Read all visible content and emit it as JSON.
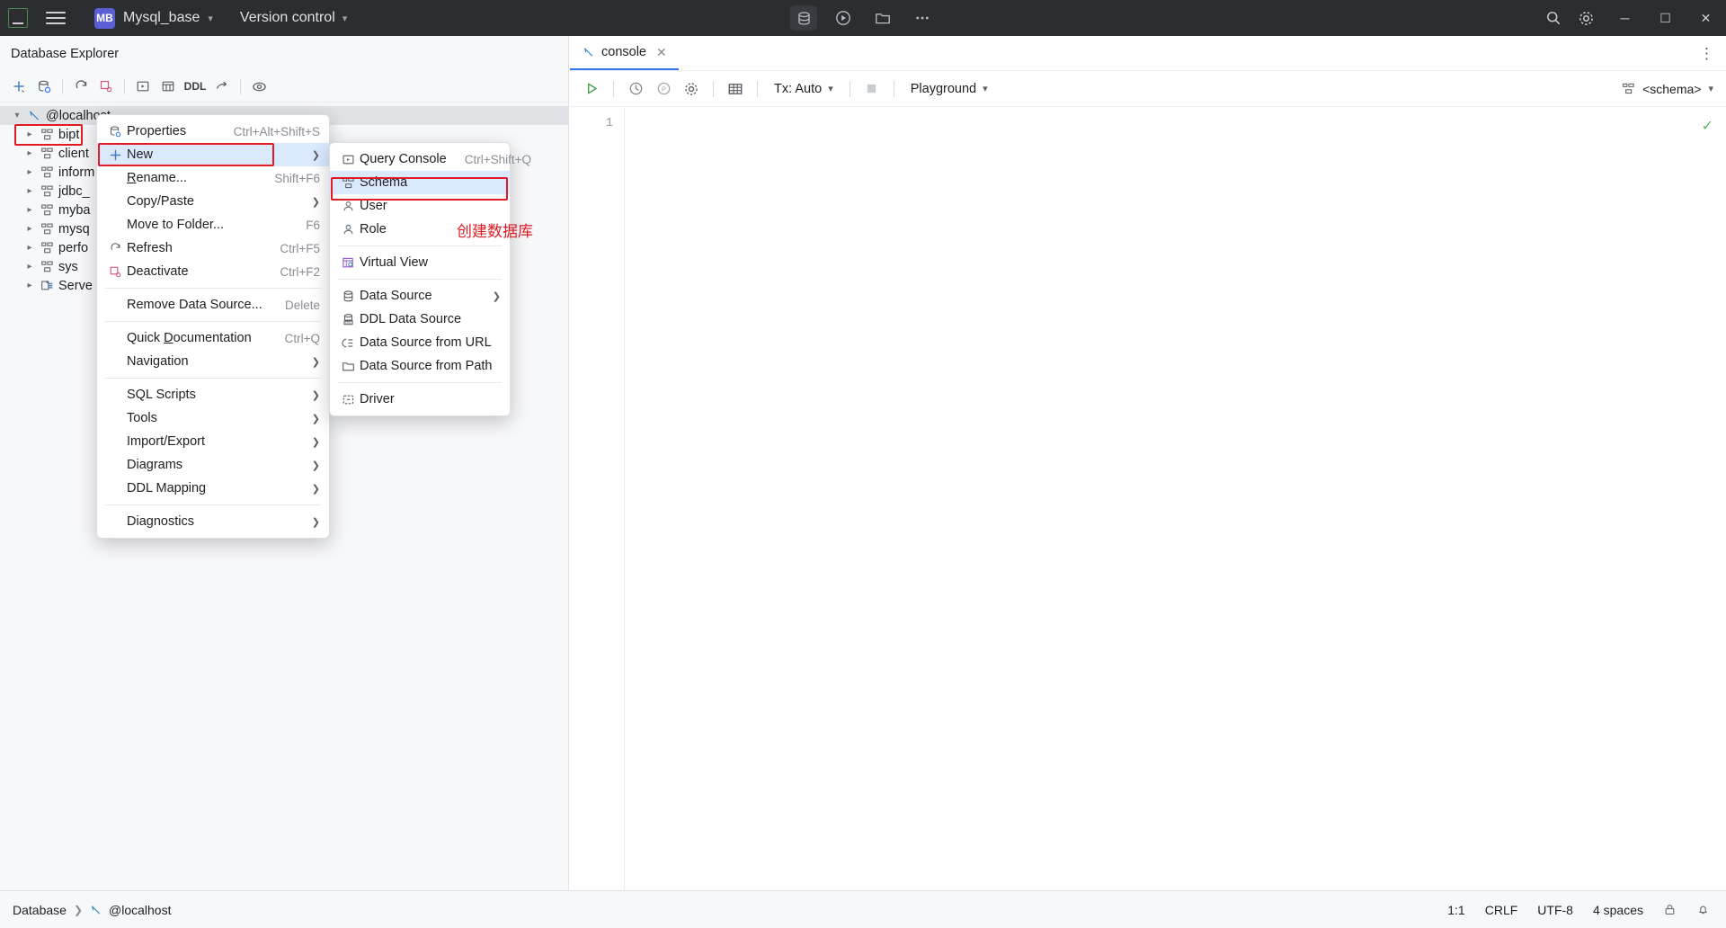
{
  "titlebar": {
    "logo": "DG",
    "menu_icon": "hamburger-icon",
    "project_badge": "MB",
    "project_name": "Mysql_base",
    "vcs_label": "Version control",
    "center_icons": [
      "database-icon",
      "run-icon",
      "folder-icon",
      "more-icon"
    ],
    "right_icons": [
      "search-icon",
      "settings-icon"
    ],
    "window_buttons": {
      "minimize": "─",
      "maximize": "☐",
      "close": "✕"
    }
  },
  "left_panel": {
    "title": "Database Explorer",
    "toolbar_icons": [
      "add-icon",
      "datasource-properties-icon",
      "refresh-icon",
      "deactivate-icon",
      "console-icon",
      "table-editor-icon",
      "ddl-icon",
      "jump-icon",
      "filter-icon"
    ],
    "toolbar_ddl_label": "DDL",
    "tree": [
      {
        "label": "@localhost",
        "icon": "datasource-icon",
        "expanded": true,
        "selected": true,
        "indent": 0
      },
      {
        "label": "bipt",
        "icon": "schema-icon",
        "expanded": false,
        "selected": false,
        "indent": 1
      },
      {
        "label": "client",
        "icon": "schema-icon",
        "expanded": false,
        "selected": false,
        "indent": 1
      },
      {
        "label": "inform",
        "icon": "schema-icon",
        "expanded": false,
        "selected": false,
        "indent": 1
      },
      {
        "label": "jdbc_",
        "icon": "schema-icon",
        "expanded": false,
        "selected": false,
        "indent": 1
      },
      {
        "label": "myba",
        "icon": "schema-icon",
        "expanded": false,
        "selected": false,
        "indent": 1
      },
      {
        "label": "mysq",
        "icon": "schema-icon",
        "expanded": false,
        "selected": false,
        "indent": 1
      },
      {
        "label": "perfo",
        "icon": "schema-icon",
        "expanded": false,
        "selected": false,
        "indent": 1
      },
      {
        "label": "sys",
        "icon": "schema-icon",
        "expanded": false,
        "selected": false,
        "indent": 1
      },
      {
        "label": "Serve",
        "icon": "server-objects-icon",
        "expanded": false,
        "selected": false,
        "indent": 1
      }
    ]
  },
  "context_menu": {
    "items": [
      {
        "label": "Properties",
        "accel": "Ctrl+Alt+Shift+S",
        "icon": "properties-icon",
        "arrow": false,
        "highlight": false
      },
      {
        "label": "New",
        "accel": "",
        "icon": "plus-icon",
        "arrow": true,
        "highlight": true
      },
      {
        "label": "Rename...",
        "accel": "Shift+F6",
        "icon": "",
        "arrow": false,
        "highlight": false
      },
      {
        "label": "Copy/Paste",
        "accel": "",
        "icon": "",
        "arrow": true,
        "highlight": false
      },
      {
        "label": "Move to Folder...",
        "accel": "F6",
        "icon": "",
        "arrow": false,
        "highlight": false
      },
      {
        "label": "Refresh",
        "accel": "Ctrl+F5",
        "icon": "refresh-icon",
        "arrow": false,
        "highlight": false
      },
      {
        "label": "Deactivate",
        "accel": "Ctrl+F2",
        "icon": "deactivate-icon",
        "arrow": false,
        "highlight": false
      },
      {
        "separator": true
      },
      {
        "label": "Remove Data Source...",
        "accel": "Delete",
        "icon": "",
        "arrow": false,
        "highlight": false
      },
      {
        "separator": true
      },
      {
        "label": "Quick Documentation",
        "accel": "Ctrl+Q",
        "icon": "",
        "arrow": false,
        "highlight": false
      },
      {
        "label": "Navigation",
        "accel": "",
        "icon": "",
        "arrow": true,
        "highlight": false
      },
      {
        "separator": true
      },
      {
        "label": "SQL Scripts",
        "accel": "",
        "icon": "",
        "arrow": true,
        "highlight": false
      },
      {
        "label": "Tools",
        "accel": "",
        "icon": "",
        "arrow": true,
        "highlight": false
      },
      {
        "label": "Import/Export",
        "accel": "",
        "icon": "",
        "arrow": true,
        "highlight": false
      },
      {
        "label": "Diagrams",
        "accel": "",
        "icon": "",
        "arrow": true,
        "highlight": false
      },
      {
        "label": "DDL Mapping",
        "accel": "",
        "icon": "",
        "arrow": true,
        "highlight": false
      },
      {
        "separator": true
      },
      {
        "label": "Diagnostics",
        "accel": "",
        "icon": "",
        "arrow": true,
        "highlight": false
      }
    ]
  },
  "submenu": {
    "items": [
      {
        "label": "Query Console",
        "accel": "Ctrl+Shift+Q",
        "icon": "query-console-icon",
        "arrow": false,
        "highlight": false
      },
      {
        "label": "Schema",
        "accel": "",
        "icon": "schema-icon",
        "arrow": false,
        "highlight": true
      },
      {
        "label": "User",
        "accel": "",
        "icon": "user-icon",
        "arrow": false,
        "highlight": false
      },
      {
        "label": "Role",
        "accel": "",
        "icon": "role-icon",
        "arrow": false,
        "highlight": false
      },
      {
        "separator": true
      },
      {
        "label": "Virtual View",
        "accel": "",
        "icon": "virtual-view-icon",
        "arrow": false,
        "highlight": false
      },
      {
        "separator": true
      },
      {
        "label": "Data Source",
        "accel": "",
        "icon": "data-source-icon",
        "arrow": true,
        "highlight": false
      },
      {
        "label": "DDL Data Source",
        "accel": "",
        "icon": "ddl-data-source-icon",
        "arrow": false,
        "highlight": false
      },
      {
        "label": "Data Source from URL",
        "accel": "",
        "icon": "url-icon",
        "arrow": false,
        "highlight": false
      },
      {
        "label": "Data Source from Path",
        "accel": "",
        "icon": "folder-icon",
        "arrow": false,
        "highlight": false
      },
      {
        "separator": true
      },
      {
        "label": "Driver",
        "accel": "",
        "icon": "driver-icon",
        "arrow": false,
        "highlight": false
      }
    ]
  },
  "annotation": {
    "text": "创建数据库",
    "color": "#e01b24"
  },
  "editor": {
    "tab_label": "console",
    "tab_icon": "console-icon",
    "tab_close": "✕",
    "toolbar": {
      "run_label": "run-icon",
      "history_label": "history-icon",
      "param_label": "parameters-icon",
      "settings_label": "settings-icon",
      "grid_label": "grid-icon",
      "tx_label": "Tx: Auto",
      "stop_label": "stop-icon",
      "schema_selector": "Playground",
      "right_schema": "<schema>"
    },
    "line_numbers": [
      "1"
    ],
    "content": ""
  },
  "statusbar": {
    "breadcrumb": [
      "Database",
      "@localhost"
    ],
    "caret": "1:1",
    "line_sep": "CRLF",
    "encoding": "UTF-8",
    "indent": "4 spaces",
    "icons": [
      "lock-icon",
      "bell-icon"
    ]
  }
}
